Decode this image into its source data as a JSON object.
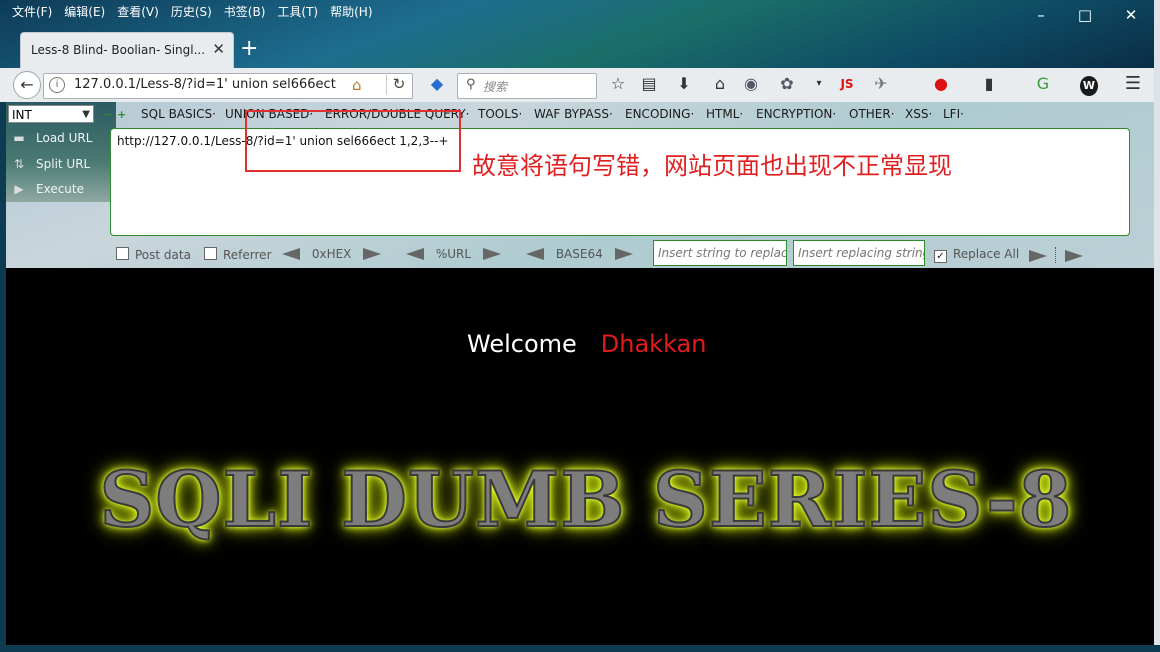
{
  "menubar": {
    "items": [
      "文件(F)",
      "编辑(E)",
      "查看(V)",
      "历史(S)",
      "书签(B)",
      "工具(T)",
      "帮助(H)"
    ]
  },
  "window_controls": {
    "minimize": "–",
    "maximize": "□",
    "close": "✕"
  },
  "tab": {
    "title": "Less-8 Blind- Boolian- Singl..."
  },
  "navbar": {
    "url": "127.0.0.1/Less-8/?id=1' union sel666ect",
    "search_placeholder": "搜索",
    "js_label": "JS"
  },
  "hackbar": {
    "type_select": "INT",
    "menus": [
      "SQL BASICS·",
      "UNION BASED·",
      "ERROR/DOUBLE QUERY·",
      "TOOLS·",
      "WAF BYPASS·",
      "ENCODING·",
      "HTML·",
      "ENCRYPTION·",
      "OTHER·",
      "XSS·",
      "LFI·"
    ],
    "side": {
      "load": "Load URL",
      "split": "Split URL",
      "execute": "Execute"
    },
    "textarea_value": "http://127.0.0.1/Less-8/?id=1' union sel666ect 1,2,3--+",
    "post_data_label": "Post data",
    "referrer_label": "Referrer",
    "hex_label": "0xHEX",
    "url_label": "%URL",
    "base64_label": "BASE64",
    "replace_placeholder": "Insert string to replace",
    "replacing_placeholder": "Insert replacing string",
    "replace_all_label": "Replace All"
  },
  "annotation": {
    "text": "故意将语句写错，网站页面也出现不正常显现",
    "color": "#e02020"
  },
  "page": {
    "welcome": "Welcome",
    "name": "Dhakkan",
    "banner": "SQLI DUMB SERIES-8"
  },
  "colors": {
    "name_red": "#e41b1b",
    "glow": "#e8ff3a",
    "border_green": "#2d8a2d"
  }
}
